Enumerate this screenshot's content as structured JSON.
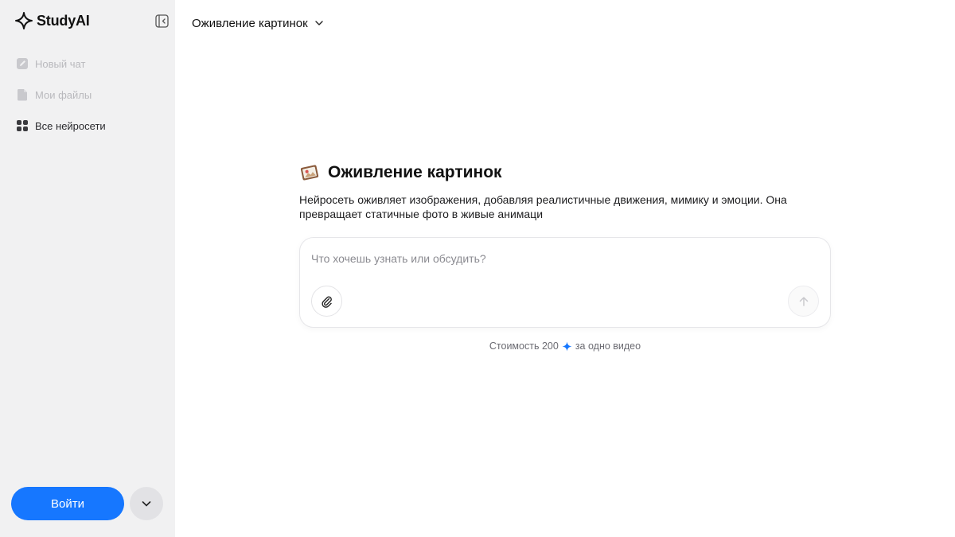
{
  "brand": {
    "name": "StudyAI"
  },
  "sidebar": {
    "items": [
      {
        "label": "Новый чат",
        "icon": "edit-icon",
        "disabled": true
      },
      {
        "label": "Мои файлы",
        "icon": "file-icon",
        "disabled": true
      },
      {
        "label": "Все нейросети",
        "icon": "grid-icon",
        "disabled": false
      }
    ],
    "login_label": "Войти"
  },
  "header": {
    "model_name": "Оживление картинок"
  },
  "main": {
    "title": "Оживление картинок",
    "description": "Нейросеть оживляет изображения, добавляя реалистичные движения, мимику и эмоции. Она превращает статичные фото в живые анимаци",
    "composer": {
      "placeholder": "Что хочешь узнать или обсудить?",
      "value": ""
    },
    "cost": {
      "prefix": "Стоимость 200",
      "suffix": "за одно видео"
    }
  },
  "colors": {
    "accent": "#1677ff",
    "sidebar_bg": "#f1f1f2",
    "spark": "#1677ff"
  }
}
